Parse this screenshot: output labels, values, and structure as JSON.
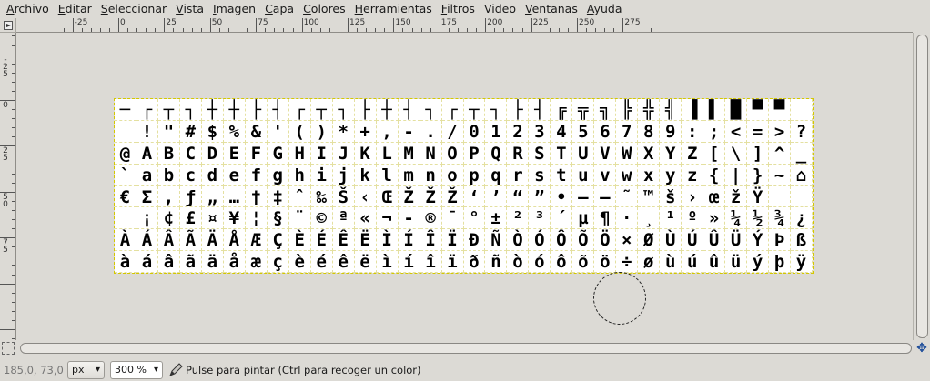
{
  "menubar": {
    "items": [
      {
        "label": "Archivo",
        "mnemonic": "A",
        "rest": "rchivo"
      },
      {
        "label": "Editar",
        "mnemonic": "E",
        "rest": "ditar"
      },
      {
        "label": "Seleccionar",
        "mnemonic": "S",
        "rest": "eleccionar"
      },
      {
        "label": "Vista",
        "mnemonic": "V",
        "rest": "ista"
      },
      {
        "label": "Imagen",
        "mnemonic": "I",
        "rest": "magen"
      },
      {
        "label": "Capa",
        "mnemonic": "C",
        "rest": "apa"
      },
      {
        "label": "Colores",
        "mnemonic": "C",
        "rest": "olores"
      },
      {
        "label": "Herramientas",
        "mnemonic": "H",
        "rest": "erramientas"
      },
      {
        "label": "Filtros",
        "mnemonic": "F",
        "rest": "iltros"
      },
      {
        "label": "Video",
        "mnemonic": "",
        "rest": "Video"
      },
      {
        "label": "Ventanas",
        "mnemonic": "V",
        "rest": "entanas"
      },
      {
        "label": "Ayuda",
        "mnemonic": "A",
        "rest": "yuda"
      }
    ]
  },
  "hruler": {
    "labels": [
      "-25",
      "0",
      "25",
      "50",
      "75",
      "100",
      "125",
      "150",
      "175",
      "200",
      "225",
      "250",
      "275"
    ]
  },
  "vruler": {
    "labels": [
      "-25",
      "0",
      "25",
      "50",
      "75"
    ]
  },
  "glyph_rows": [
    "─┌┬┐┼┼├┤┌┬┐├┼┤┐┌┬┐├┤╔╦╗╠╬╣▐▌█▀▀",
    " !\"#$%&'()*+,-./0123456789:;<=>?",
    "@ABCDEFGHIJKLMNOPQRSTUVWXYZ[\\]^_",
    "`abcdefghijklmnopqrstuvwxyz{|}~⌂",
    "€Σ‚ƒ„…†‡ˆ‰Š‹ŒŽŽŽ‘’“”•–—˜™š›œžŸ",
    " ¡¢£¤¥¦§¨©ª«¬-®¯°±²³´µ¶·¸¹º»¼½¾¿",
    "ÀÁÂÃÄÅÆÇÈÉÊËÌÍÎÏÐÑÒÓÔÕÖ×ØÙÚÛÜÝÞß",
    "àáâãäåæçèéêëìíîïðñòóôõö÷øùúûüýþÿ"
  ],
  "statusbar": {
    "coords": "185,0, 73,0",
    "unit": "px",
    "zoom": "300 %",
    "message": "Pulse para pintar (Ctrl para recoger un color)"
  },
  "colors": {
    "background": "#dcdad5",
    "selection_outline": "#d4c800",
    "nav_icon": "#1e4d9a"
  },
  "icons": {
    "ruler_corner": "quick-menu-arrow-icon",
    "quick_mask": "quick-mask-icon",
    "navigate": "navigate-arrows-icon",
    "paint_tool": "pencil-icon"
  }
}
